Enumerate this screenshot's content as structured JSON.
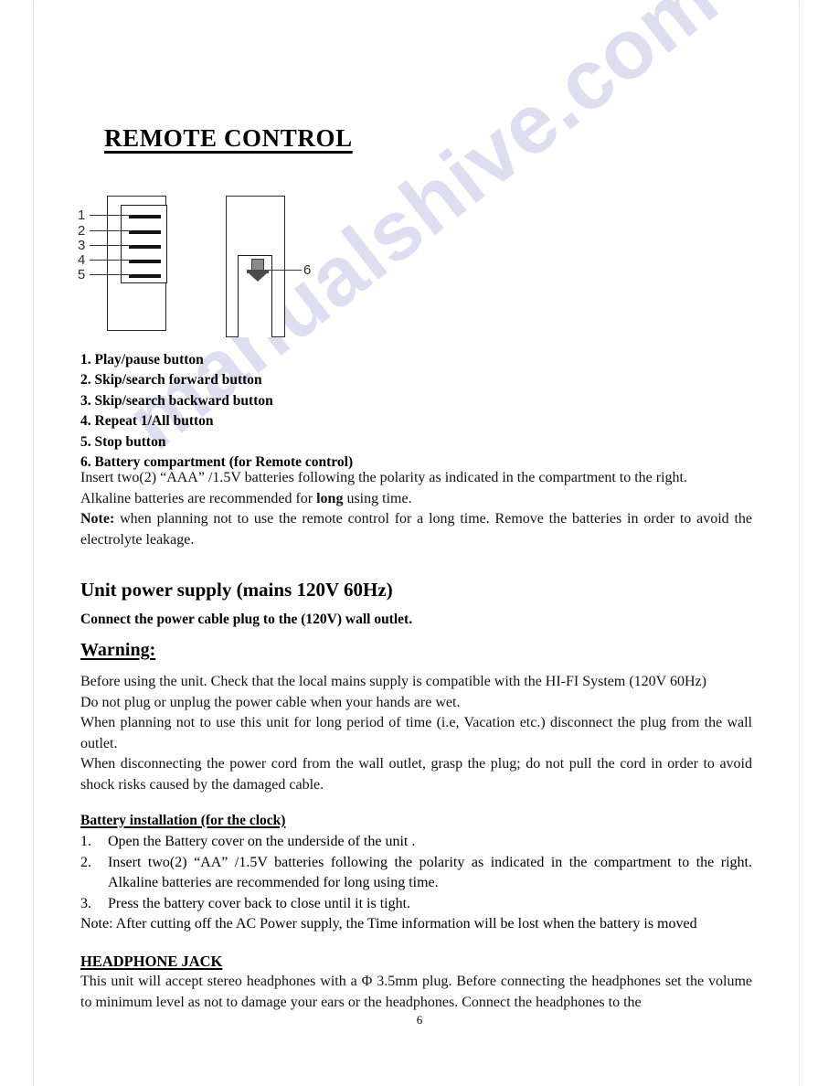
{
  "document": {
    "title": "REMOTE CONTROL",
    "page_number": "6",
    "watermark": "manualshive.com"
  },
  "diagram": {
    "left_remote_callouts": [
      "1",
      "2",
      "3",
      "4",
      "5"
    ],
    "right_remote_callout": "6",
    "battery_arrow_icon": "battery-insert-arrow-icon"
  },
  "button_list": [
    "1. Play/pause button",
    "2. Skip/search forward button",
    "3. Skip/search backward button",
    "4. Repeat 1/All button",
    "5. Stop button",
    "6. Battery compartment (for Remote control)"
  ],
  "battery_paragraph": {
    "line1": "Insert two(2)  “AAA” /1.5V batteries following the polarity as indicated in the compartment to the right.",
    "line2_a": "Alkaline batteries are recommended for ",
    "line2_bold": "long",
    "line2_b": " using time.",
    "note_label": "Note:",
    "note_text": " when planning not to use the remote control for a long time. Remove the batteries in order to avoid the electrolyte leakage."
  },
  "power_supply": {
    "heading": "Unit power supply (mains 120V 60Hz)",
    "subheading": "Connect the power cable plug to the (120V) wall outlet.",
    "warning_heading": "Warning:",
    "warning_lines": [
      "Before using the unit. Check that the local mains supply is compatible with the HI-FI System (120V 60Hz)",
      "Do not plug or unplug the power cable when your hands are wet.",
      "When planning not to use this unit for long period of time (i.e, Vacation etc.) disconnect the plug from the wall outlet.",
      "When disconnecting the power cord from the wall outlet, grasp the plug; do not pull the cord in order to avoid shock risks caused by the damaged cable."
    ]
  },
  "battery_installation": {
    "heading": "Battery installation (for the clock)",
    "items": [
      {
        "marker": "1.",
        "text": "Open the Battery cover on the underside of the unit ."
      },
      {
        "marker": "2.",
        "text": "Insert two(2) “AA” /1.5V batteries following the polarity as indicated in the compartment to the right. Alkaline batteries are recommended for long using time."
      },
      {
        "marker": "3.",
        "text": "Press the battery cover back to close until it is tight."
      }
    ],
    "note": "Note: After cutting off the AC Power supply, the Time information will be lost when the battery is moved"
  },
  "headphone_jack": {
    "heading": "HEADPHONE JACK",
    "text": "This unit will accept stereo headphones with a  Φ  3.5mm plug. Before connecting the headphones set the volume to minimum level as not to damage your ears or the headphones. Connect the headphones to the"
  }
}
